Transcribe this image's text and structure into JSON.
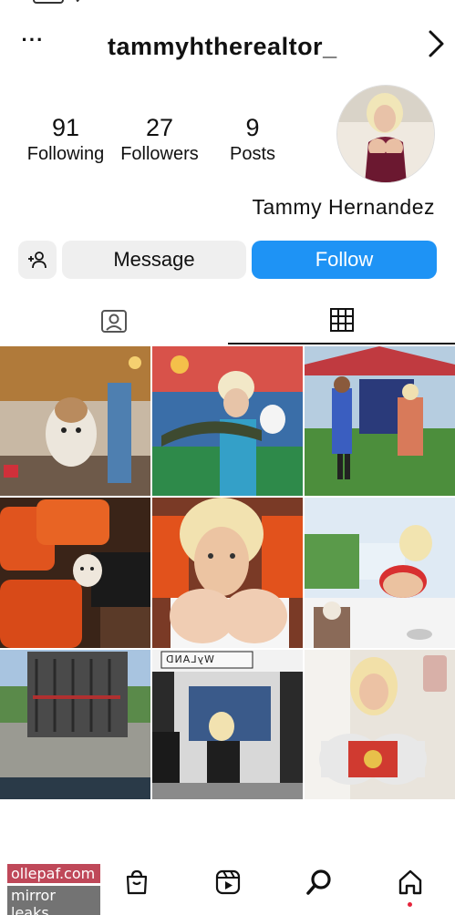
{
  "header": {
    "username": "tammyhtherealtor_",
    "more_icon": "more-horizontal-icon",
    "back_icon": "chevron-right-icon"
  },
  "profile": {
    "display_name": "Tammy Hernandez",
    "stats": {
      "posts": {
        "value": "9",
        "label": "Posts"
      },
      "followers": {
        "value": "27",
        "label": "Followers"
      },
      "following": {
        "value": "91",
        "label": "Following"
      }
    }
  },
  "actions": {
    "follow_label": "Follow",
    "message_label": "Message",
    "add_user_icon": "add-user-icon"
  },
  "tabs": [
    {
      "name": "grid",
      "icon": "grid-icon",
      "active": true
    },
    {
      "name": "tagged",
      "icon": "tagged-person-icon",
      "active": false
    }
  ],
  "posts": [
    {
      "index": 1,
      "overlay_text": ""
    },
    {
      "index": 2,
      "overlay_text": ""
    },
    {
      "index": 3,
      "overlay_text": ""
    },
    {
      "index": 4,
      "overlay_text": ""
    },
    {
      "index": 5,
      "overlay_text": ""
    },
    {
      "index": 6,
      "overlay_text": ""
    },
    {
      "index": 7,
      "overlay_text": ""
    },
    {
      "index": 8,
      "overlay_text": "WyLAND"
    },
    {
      "index": 9,
      "overlay_text": ""
    }
  ],
  "watermark": {
    "line1": "ollepaf.com",
    "line2": "mirror leaks"
  },
  "bottom_nav": [
    {
      "name": "shop",
      "icon": "shopping-bag-icon"
    },
    {
      "name": "reels",
      "icon": "reels-icon"
    },
    {
      "name": "search",
      "icon": "search-icon"
    },
    {
      "name": "home",
      "icon": "home-icon"
    }
  ],
  "colors": {
    "follow_button": "#1e93f5",
    "secondary_button": "#efefef",
    "notification_dot": "#e5243b"
  }
}
